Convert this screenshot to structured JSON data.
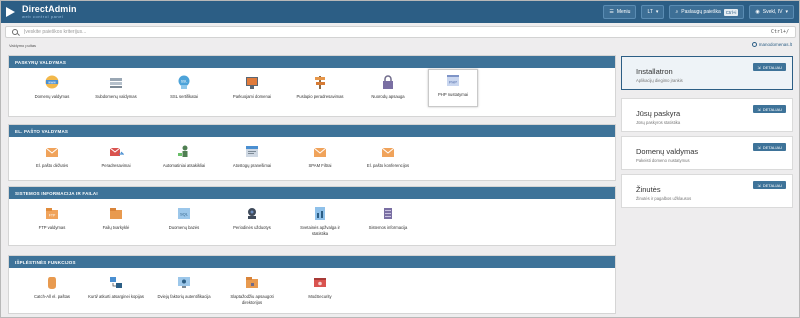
{
  "app": {
    "title": "DirectAdmin",
    "subtitle": "web control panel"
  },
  "topbar": {
    "menu_label": "Meniu",
    "lang_label": "LT",
    "search_label": "Paslaugų paieška",
    "search_kbd": "Ctrl+i",
    "user_label": "Svekl, IV"
  },
  "search": {
    "placeholder": "Įveskite paieškos kriterijus...",
    "shortcut": "Ctrl+/"
  },
  "breadcrumb": "Valdymo pultas",
  "domain": "manodomenas.lt",
  "sections": [
    {
      "title": "PASKYRŲ VALDYMAS",
      "items": [
        {
          "label": "Domenų valdymas",
          "icon": "domain-icon"
        },
        {
          "label": "Subdomenų valdymas",
          "icon": "subdomain-icon"
        },
        {
          "label": "SSL sertifikatai",
          "icon": "ssl-icon"
        },
        {
          "label": "Parkuojami domenai",
          "icon": "parked-domain-icon"
        },
        {
          "label": "Puslapio peradresavimas",
          "icon": "redirect-icon"
        },
        {
          "label": "Nuorodų apsauga",
          "icon": "lock-icon"
        },
        {
          "label": "PHP nustatymai",
          "icon": "php-icon"
        }
      ]
    },
    {
      "title": "EL. PAŠTO VALDYMAS",
      "items": [
        {
          "label": "El. pašto dėžutės",
          "icon": "mailbox-icon"
        },
        {
          "label": "Peradresavimai",
          "icon": "mail-forward-icon"
        },
        {
          "label": "Automatiniai atsakikliai",
          "icon": "autoresponder-icon"
        },
        {
          "label": "Atostogų pranešimai",
          "icon": "vacation-icon"
        },
        {
          "label": "SPAM Filtrai",
          "icon": "spam-filter-icon"
        },
        {
          "label": "El. pašto konferencijos",
          "icon": "mailing-list-icon"
        }
      ]
    },
    {
      "title": "SISTEMOS INFORMACIJA IR FAILAI",
      "items": [
        {
          "label": "FTP valdymas",
          "icon": "ftp-icon"
        },
        {
          "label": "Failų tvarkyklė",
          "icon": "file-manager-icon"
        },
        {
          "label": "Duomenų bazės",
          "icon": "database-icon"
        },
        {
          "label": "Periodinės užduotys",
          "icon": "cron-icon"
        },
        {
          "label": "Svetainės apžvalga ir statistika",
          "icon": "statistics-icon"
        },
        {
          "label": "Sistemos informacija",
          "icon": "system-info-icon"
        }
      ]
    },
    {
      "title": "IŠPLĖSTINĖS FUNKCIJOS",
      "items": [
        {
          "label": "Catch-All el. paštas",
          "icon": "catch-all-icon"
        },
        {
          "label": "Kurti/ atkurti atsarginei kopijas",
          "icon": "backup-icon"
        },
        {
          "label": "Dviejų faktorių autentifikacija",
          "icon": "two-factor-icon"
        },
        {
          "label": "Slaptažodžiu apsaugoti direktorijos",
          "icon": "protected-dir-icon"
        },
        {
          "label": "ModSecurity",
          "icon": "modsecurity-icon"
        }
      ]
    }
  ],
  "cards": [
    {
      "title": "Installatron",
      "desc": "Aplikacijų diegimo įrankis",
      "button": "DETALIAU"
    },
    {
      "title": "Jūsų paskyra",
      "desc": "Jūsų paskyros statistika",
      "button": "DETALIAU"
    },
    {
      "title": "Domenų valdymas",
      "desc": "Pakeisti domeno nustatymus",
      "button": "DETALIAU"
    },
    {
      "title": "Žinutės",
      "desc": "Žinutės ir pagalbos užklausos",
      "button": "DETALIAU"
    }
  ],
  "colors": {
    "topbar": "#2c5e85",
    "section_header": "#3e7399",
    "accent": "#3e7399"
  }
}
